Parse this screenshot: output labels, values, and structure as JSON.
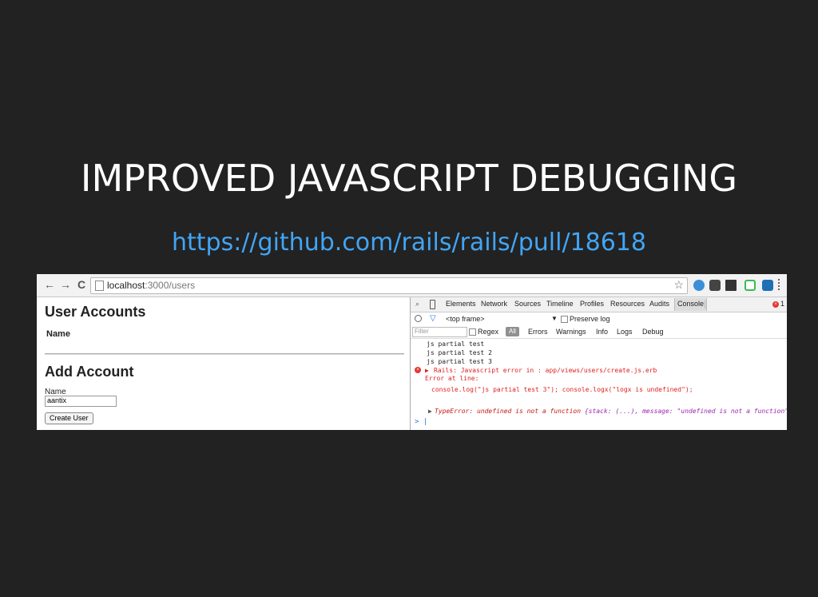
{
  "slide": {
    "title": "IMPROVED JAVASCRIPT DEBUGGING",
    "link": "https://github.com/rails/rails/pull/18618"
  },
  "browser": {
    "url_host": "localhost",
    "url_rest": ":3000/users",
    "back_icon": "←",
    "forward_icon": "→",
    "reload_icon": "C",
    "star_icon": "☆"
  },
  "page": {
    "accounts_heading": "User Accounts",
    "name_column": "Name",
    "add_heading": "Add Account",
    "name_label": "Name",
    "name_value": "aantix",
    "create_button": "Create User"
  },
  "devtools": {
    "tabs": [
      "Elements",
      "Network",
      "Sources",
      "Timeline",
      "Profiles",
      "Resources",
      "Audits",
      "Console"
    ],
    "error_count": "1",
    "frame": "<top frame>",
    "preserve_log": "Preserve log",
    "filter_placeholder": "Filter",
    "regex": "Regex",
    "levels": [
      "All",
      "Errors",
      "Warnings",
      "Info",
      "Logs",
      "Debug"
    ],
    "console": {
      "line1": "js partial test",
      "line2": "js partial test 2",
      "line3": "js partial test 3",
      "err_title": "Rails: Javascript error in : app/views/users/create.js.erb",
      "err_at": "Error at line:",
      "err_code": "console.log(\"js partial test 3\"); console.logx(\"logx is undefined\");",
      "type_error": "TypeError: undefined is not a function",
      "type_error_detail": " {stack: (...), message: \"undefined is not a function\"}",
      "prompt": "> |"
    }
  }
}
